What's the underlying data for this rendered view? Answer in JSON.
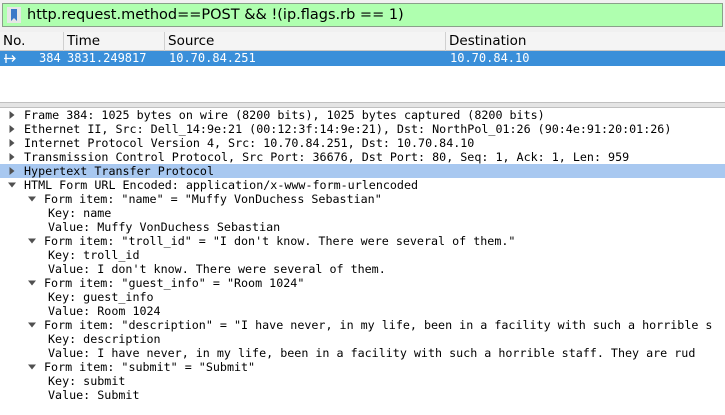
{
  "filter": {
    "value": "http.request.method==POST && !(ip.flags.rb == 1)",
    "icon": "bookmark-icon",
    "bg_color": "#afffaf"
  },
  "packet_list": {
    "columns": [
      "No.",
      "Time",
      "Source",
      "Destination"
    ],
    "rows": [
      {
        "no": "384",
        "time": "3831.249817",
        "source": "10.70.84.251",
        "destination": "10.70.84.10"
      }
    ],
    "selected_color": "#3a8fd9"
  },
  "details": [
    {
      "text": "Frame 384: 1025 bytes on wire (8200 bits), 1025 bytes captured (8200 bits)",
      "state": "collapsed"
    },
    {
      "text": "Ethernet II, Src: Dell_14:9e:21 (00:12:3f:14:9e:21), Dst: NorthPol_01:26 (90:4e:91:20:01:26)",
      "state": "collapsed"
    },
    {
      "text": "Internet Protocol Version 4, Src: 10.70.84.251, Dst: 10.70.84.10",
      "state": "collapsed"
    },
    {
      "text": "Transmission Control Protocol, Src Port: 36676, Dst Port: 80, Seq: 1, Ack: 1, Len: 959",
      "state": "collapsed"
    },
    {
      "text": "Hypertext Transfer Protocol",
      "state": "collapsed",
      "selected": true
    },
    {
      "text": "HTML Form URL Encoded: application/x-www-form-urlencoded",
      "state": "expanded"
    },
    {
      "text": "Form item: \"name\" = \"Muffy VonDuchess Sebastian\"",
      "state": "expanded"
    },
    {
      "text": "Key: name",
      "state": "leaf"
    },
    {
      "text": "Value: Muffy VonDuchess Sebastian",
      "state": "leaf"
    },
    {
      "text": "Form item: \"troll_id\" = \"I don't know. There were several of them.\"",
      "state": "expanded"
    },
    {
      "text": "Key: troll_id",
      "state": "leaf"
    },
    {
      "text": "Value: I don't know. There were several of them.",
      "state": "leaf"
    },
    {
      "text": "Form item: \"guest_info\" = \"Room 1024\"",
      "state": "expanded"
    },
    {
      "text": "Key: guest_info",
      "state": "leaf"
    },
    {
      "text": "Value: Room 1024",
      "state": "leaf"
    },
    {
      "text": "Form item: \"description\" = \"I have never, in my life, been in a facility with such a horrible s",
      "state": "expanded"
    },
    {
      "text": "Key: description",
      "state": "leaf"
    },
    {
      "text": "Value: I have never, in my life, been in a facility with such a horrible staff. They are rud",
      "state": "leaf"
    },
    {
      "text": "Form item: \"submit\" = \"Submit\"",
      "state": "expanded"
    },
    {
      "text": "Key: submit",
      "state": "leaf"
    },
    {
      "text": "Value: Submit",
      "state": "leaf"
    }
  ]
}
